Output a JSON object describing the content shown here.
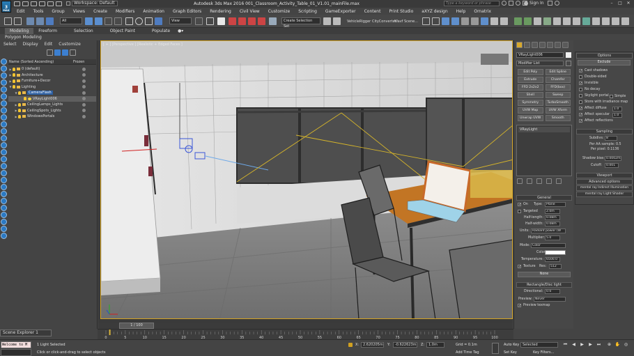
{
  "app": {
    "logo_text": "MAX",
    "workspace_label": "Workspace: Default",
    "window_title": "Autodesk 3ds Max 2016    001_Classroom_Activity_Table_01_V1.01_mainFile.max",
    "search_placeholder": "Type a keyword or phrase",
    "signin": "Sign In"
  },
  "menu": [
    "Edit",
    "Tools",
    "Group",
    "Views",
    "Create",
    "Modifiers",
    "Animation",
    "Graph Editors",
    "Rendering",
    "Civil View",
    "Customize",
    "Scripting",
    "GameExporter",
    "Content",
    "Print Studio",
    "aXYZ design",
    "Help",
    "Ornatrix"
  ],
  "toolbar": {
    "filter_select": "All",
    "view_select": "View",
    "selection_set": "Create Selection Set",
    "plugin_labels": [
      "VehicleRigger",
      "CityConverter",
      "Wavf Scene..."
    ]
  },
  "ribbon": {
    "tabs": [
      "Modeling",
      "Freeform",
      "Selection",
      "Object Paint",
      "Populate"
    ],
    "active_tab": "Modeling",
    "sub": "Polygon Modeling"
  },
  "scene_explorer": {
    "menu": [
      "Select",
      "Display",
      "Edit",
      "Customize"
    ],
    "col_name": "Name (Sorted Ascending)",
    "col_frozen": "Frozen",
    "tree": [
      {
        "label": "0 (default)",
        "indent": 0,
        "arrow": "▶",
        "type": "layer",
        "style": ""
      },
      {
        "label": "Architecture",
        "indent": 0,
        "arrow": "▶",
        "type": "layer",
        "style": ""
      },
      {
        "label": "Furniture+Decor",
        "indent": 0,
        "arrow": "▶",
        "type": "layer",
        "style": ""
      },
      {
        "label": "Lighting",
        "indent": 0,
        "arrow": "▼",
        "type": "layer",
        "style": ""
      },
      {
        "label": "CameraFlash",
        "indent": 1,
        "arrow": "▼",
        "type": "layer",
        "style": "sel-blue"
      },
      {
        "label": "VRayLight006",
        "indent": 2,
        "arrow": "",
        "type": "light",
        "style": "sel-grey"
      },
      {
        "label": "CeilingLamps_Lights",
        "indent": 1,
        "arrow": "▶",
        "type": "layer",
        "style": ""
      },
      {
        "label": "CeilingSpots_Lights",
        "indent": 1,
        "arrow": "▶",
        "type": "layer",
        "style": ""
      },
      {
        "label": "WindowsPortals",
        "indent": 1,
        "arrow": "▶",
        "type": "layer",
        "style": ""
      }
    ],
    "footer": "Scene Explorer 1"
  },
  "viewport": {
    "label": "[ + ] [Perspective ] [Realistic + Edged Faces ]"
  },
  "command_panel": {
    "object_name": "VRayLight006",
    "modifier_list": "Modifier List",
    "modifiers": [
      "Edit Poly",
      "Edit Spline",
      "Extrude",
      "Chamfer",
      "FFD 2x2x2",
      "FFD(box)",
      "Shell",
      "Sweep",
      "Symmetry",
      "TurboSmooth",
      "UVW Map",
      "UVW Xform",
      "Unwrap UVW",
      "Smooth"
    ],
    "stack_item": "VRayLight",
    "general_title": "General",
    "on_label": "On",
    "type_label": "Type:",
    "type_value": "Plane",
    "targeted_label": "Targeted",
    "targeted_value": "2.0m",
    "half_length_label": "Half-length:",
    "half_length_value": "0.08m",
    "half_width_label": "Half-width:",
    "half_width_value": "0.08m",
    "units_label": "Units:",
    "units_value": "Radiant power (W",
    "multiplier_label": "Multiplier:",
    "multiplier_value": "5.0",
    "mode_label": "Mode:",
    "mode_value": "Color",
    "color_label": "Color:",
    "temperature_label": "Temperature:",
    "temperature_value": "6500.0",
    "texture_label": "Texture",
    "res_label": "Res:",
    "res_value": "512",
    "none_button": "None",
    "rect_title": "Rectangle/Disc light",
    "directional_label": "Directional:",
    "directional_value": "0.0",
    "preview_label": "Preview:",
    "preview_value": "Never",
    "preview_texmap": "Preview texmap"
  },
  "options_panel": {
    "title": "Options",
    "exclude": "Exclude",
    "checks": [
      {
        "label": "Cast shadows",
        "checked": true
      },
      {
        "label": "Double-sided",
        "checked": false
      },
      {
        "label": "Invisible",
        "checked": true
      },
      {
        "label": "No decay",
        "checked": false
      },
      {
        "label": "Skylight portal",
        "checked": false
      },
      {
        "label": "Store with irradiance map",
        "checked": false
      },
      {
        "label": "Affect diffuse",
        "checked": true
      },
      {
        "label": "Affect specular",
        "checked": true
      },
      {
        "label": "Affect reflections",
        "checked": true
      }
    ],
    "simple_label": "Simple",
    "diffuse_value": "1.0",
    "specular_value": "1.0",
    "sampling_title": "Sampling",
    "subdivs_label": "Subdivs:",
    "subdivs_value": "8",
    "per_aa_label": "Per AA sample: 0.5",
    "per_pixel_label": "Per pixel: 0.1136",
    "shadow_bias_label": "Shadow bias:",
    "shadow_bias_value": "0.0002m",
    "cutoff_label": "Cutoff:",
    "cutoff_value": "0.001",
    "viewport_title": "Viewport",
    "advanced_title": "Advanced options",
    "mental_ray_1": "mental ray Indirect Illumination",
    "mental_ray_2": "mental ray Light Shader"
  },
  "timeline": {
    "slider": "1 / 100",
    "ticks": [
      "0",
      "5",
      "10",
      "15",
      "20",
      "25",
      "30",
      "35",
      "40",
      "45",
      "50",
      "55",
      "60",
      "65",
      "70",
      "75",
      "80",
      "85",
      "90",
      "95",
      "100"
    ]
  },
  "status": {
    "maxscript_text": "Welcome to M",
    "selected": "1 Light Selected",
    "prompt": "Click or click-and-drag to select objects",
    "x_label": "X:",
    "x_value": "2.620205m",
    "y_label": "Y:",
    "y_value": "-0.622623m",
    "z_label": "Z:",
    "z_value": "1.0m",
    "grid": "Grid = 0.1m",
    "add_time_tag": "Add Time Tag",
    "auto_key": "Auto Key",
    "set_key": "Set Key",
    "selected_dropdown": "Selected",
    "key_filters": "Key Filters..."
  }
}
